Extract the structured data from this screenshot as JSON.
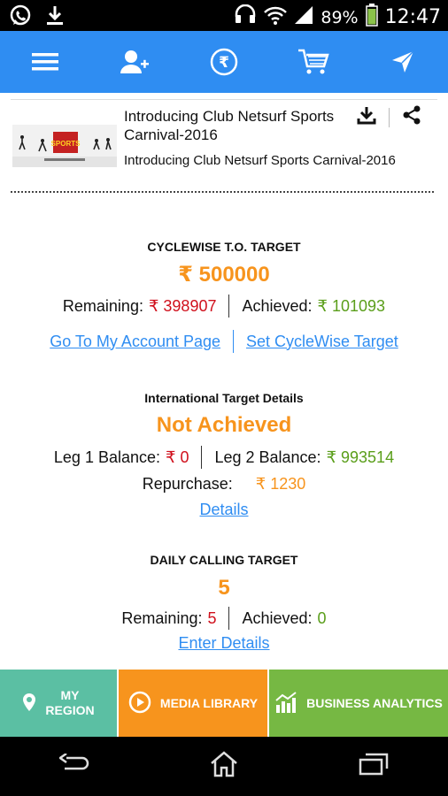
{
  "status_bar": {
    "battery": "89%",
    "time": "12:47",
    "icons": [
      "whatsapp-icon",
      "download-icon",
      "headset-icon",
      "wifi-icon",
      "signal-icon",
      "battery-icon"
    ]
  },
  "app_bar": {
    "icons": [
      "menu-icon",
      "add-user-icon",
      "rupee-icon",
      "cart-icon",
      "navigate-icon"
    ],
    "color": "#2f8df2"
  },
  "banner": {
    "title": "Introducing  Club Netsurf Sports Carnival-2016",
    "subtitle": "Introducing  Club Netsurf Sports Carnival-2016",
    "image_text": "SPORTS"
  },
  "cyclewise": {
    "title": "CYCLEWISE T.O. TARGET",
    "amount": "₹ 500000",
    "remaining_label": "Remaining:",
    "remaining_value": "₹ 398907",
    "achieved_label": "Achieved:",
    "achieved_value": "₹ 101093",
    "link_account": "Go To My Account Page",
    "link_target": "Set CycleWise Target"
  },
  "international": {
    "title": "International Target Details",
    "status": "Not Achieved",
    "leg1_label": "Leg 1 Balance:",
    "leg1_value": "₹ 0",
    "leg2_label": "Leg 2 Balance:",
    "leg2_value": "₹ 993514",
    "repurchase_label": "Repurchase:",
    "repurchase_value": "₹ 1230",
    "details_link": "Details"
  },
  "daily": {
    "title": "DAILY CALLING TARGET",
    "value": "5",
    "remaining_label": "Remaining:",
    "remaining_value": "5",
    "achieved_label": "Achieved:",
    "achieved_value": "0",
    "enter_link": "Enter Details"
  },
  "tiles": {
    "region_line1": "MY",
    "region_line2": "REGION",
    "media": "MEDIA LIBRARY",
    "business": "BUSINESS ANALYTICS"
  },
  "colors": {
    "orange": "#f7941d",
    "red": "#d0101c",
    "green": "#5a9e1a",
    "teal": "#5bbfa3",
    "lime": "#76b843"
  }
}
